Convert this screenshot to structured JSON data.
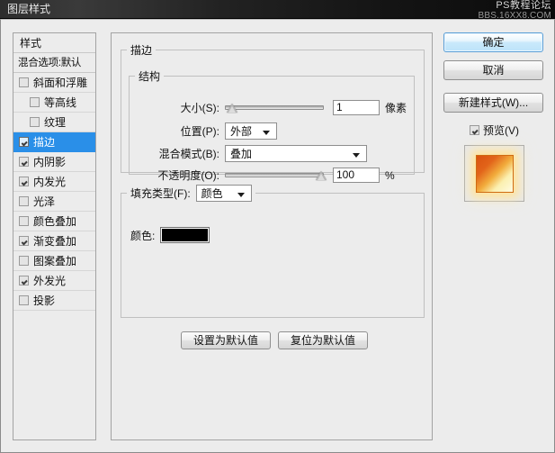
{
  "watermark": {
    "line1": "PS教程论坛",
    "line2": "BBS.16XX8.COM"
  },
  "window": {
    "title": "图层样式"
  },
  "styles_list": {
    "header": "样式",
    "blending_options": "混合选项:默认",
    "items": [
      {
        "label": "斜面和浮雕",
        "checked": false,
        "indent": false,
        "selected": false
      },
      {
        "label": "等高线",
        "checked": false,
        "indent": true,
        "selected": false
      },
      {
        "label": "纹理",
        "checked": false,
        "indent": true,
        "selected": false
      },
      {
        "label": "描边",
        "checked": true,
        "indent": false,
        "selected": true
      },
      {
        "label": "内阴影",
        "checked": true,
        "indent": false,
        "selected": false
      },
      {
        "label": "内发光",
        "checked": true,
        "indent": false,
        "selected": false
      },
      {
        "label": "光泽",
        "checked": false,
        "indent": false,
        "selected": false
      },
      {
        "label": "颜色叠加",
        "checked": false,
        "indent": false,
        "selected": false
      },
      {
        "label": "渐变叠加",
        "checked": true,
        "indent": false,
        "selected": false
      },
      {
        "label": "图案叠加",
        "checked": false,
        "indent": false,
        "selected": false
      },
      {
        "label": "外发光",
        "checked": true,
        "indent": false,
        "selected": false
      },
      {
        "label": "投影",
        "checked": false,
        "indent": false,
        "selected": false
      }
    ]
  },
  "main": {
    "group_title": "描边",
    "structure": {
      "title": "结构",
      "size": {
        "label": "大小(S):",
        "value": "1",
        "unit": "像素",
        "slider_percent": 2
      },
      "position": {
        "label": "位置(P):",
        "value": "外部"
      },
      "blend_mode": {
        "label": "混合模式(B):",
        "value": "叠加"
      },
      "opacity": {
        "label": "不透明度(O):",
        "value": "100",
        "unit": "%",
        "slider_percent": 97
      }
    },
    "fill": {
      "type_label": "填充类型(F):",
      "type_value": "颜色",
      "color_label": "颜色:",
      "color_value": "#000000"
    },
    "set_default_button": "设置为默认值",
    "reset_default_button": "复位为默认值"
  },
  "right_panel": {
    "ok_button": "确定",
    "cancel_button": "取消",
    "new_style_button": "新建样式(W)...",
    "preview_label": "预览(V)",
    "preview_checked": true
  },
  "colors": {
    "selection_blue": "#2a8fe8",
    "dialog_background": "#ececec",
    "titlebar": "#1a1a1a",
    "stroke_color": "#000000"
  }
}
